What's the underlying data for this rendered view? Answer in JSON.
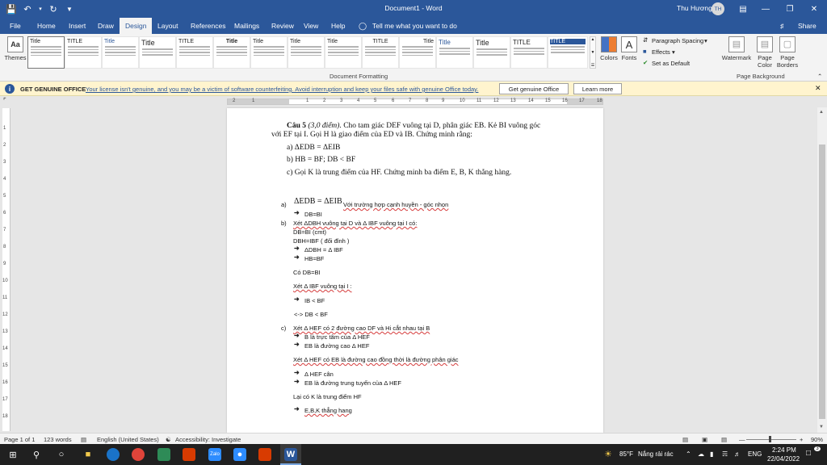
{
  "titlebar": {
    "title": "Document1 - Word",
    "user_name": "Thu Hương",
    "user_initials": "TH"
  },
  "tabs": [
    "File",
    "Home",
    "Insert",
    "Draw",
    "Design",
    "Layout",
    "References",
    "Mailings",
    "Review",
    "View",
    "Help"
  ],
  "tell_me": "Tell me what you want to do",
  "share": "Share",
  "ribbon": {
    "themes_label": "Themes",
    "style_titles": [
      "Title",
      "TITLE",
      "Title",
      "Title",
      "TITLE",
      "Title",
      "Title",
      "Title",
      "Title",
      "TITLE",
      "Title",
      "Title",
      "Title",
      "TITLE",
      "TITLE"
    ],
    "colors_label": "Colors",
    "fonts_label": "Fonts",
    "paragraph_spacing": "Paragraph Spacing",
    "effects": "Effects",
    "set_as_default": "Set as Default",
    "document_formatting": "Document Formatting",
    "watermark": "Watermark",
    "page_color": "Page Color",
    "page_borders": "Page Borders",
    "page_background": "Page Background"
  },
  "infobar": {
    "title": "GET GENUINE OFFICE",
    "message": "Your license isn't genuine, and you may be a victim of software counterfeiting. Avoid interruption and keep your files safe with genuine Office today.",
    "button_genuine": "Get genuine Office",
    "button_learn": "Learn more"
  },
  "ruler": {
    "numbers": [
      "2",
      "1",
      "1",
      "2",
      "3",
      "4",
      "5",
      "6",
      "7",
      "8",
      "9",
      "10",
      "11",
      "12",
      "13",
      "14",
      "15",
      "16",
      "17",
      "18",
      "19"
    ]
  },
  "vruler": {
    "numbers": [
      "1",
      "2",
      "3",
      "4",
      "5",
      "6",
      "7",
      "8",
      "9",
      "10",
      "11",
      "12",
      "13",
      "14",
      "15",
      "16",
      "17",
      "18",
      "19"
    ]
  },
  "document": {
    "problem": {
      "line1_bold": "Câu 5",
      "line1_italic": "(3,0 điểm).",
      "line1_rest": "Cho tam giác DEF vuông tại D, phân giác EB. Kẻ BI vuông góc",
      "line2": "với EF tại I. Gọi H là giao điểm của ED và IB. Chứng minh rằng:",
      "a": "a) ΔEDB = ΔEIB",
      "b": "b) HB = BF; DB < BF",
      "c": "c) Gọi K là trung điểm của HF. Chứng minh ba điểm E, B, K thẳng hàng."
    },
    "sol_a": {
      "label": "a)",
      "formula": "ΔEDB = ΔEIB",
      "text": "Với trường hợp cạnh huyền - góc nhọn",
      "l1": "DB=BI"
    },
    "sol_b": {
      "label": "b)",
      "l1": "Xét ΔDBH vuông tại D và Δ IBF vuông tại I có:",
      "l2": "DB=BI (cmt)",
      "l3": "DBH=IBF ( đối đỉnh )",
      "l4": "ΔDBH = Δ IBF",
      "l5": "HB=BF",
      "l6": "Có DB=BI",
      "l7": "Xét Δ IBF vuông tại I :",
      "l8": "IB < BF",
      "l9": "<-> DB < BF"
    },
    "sol_c": {
      "label": "c)",
      "l1": "Xét Δ HEF có 2 đường cao DF và Hi cắt nhau tại B",
      "l2": "B là trực tâm của Δ HEF",
      "l3": "EB là đường cao Δ HEF",
      "l4": "Xét Δ HEF có EB là đường cao đồng thời là đường phân giác",
      "l5": "Δ HEF cân",
      "l6": "EB là đường trung tuyến của Δ HEF",
      "l7": "Lại có K là trung điểm HF",
      "l8": "E,B,K thẳng hang"
    }
  },
  "status": {
    "page": "Page 1 of 1",
    "words": "123 words",
    "language": "English (United States)",
    "accessibility": "Accessibility: Investigate",
    "zoom": "90%"
  },
  "taskbar": {
    "weather": "85°F",
    "weather_desc": "Nắng rải rác",
    "lang": "ENG",
    "time": "2:24 PM",
    "date": "22/04/2022",
    "notifications": "3"
  },
  "colors": {
    "accent": "#2b579a",
    "infobar": "#fff4ce",
    "taskbar": "#202020"
  }
}
